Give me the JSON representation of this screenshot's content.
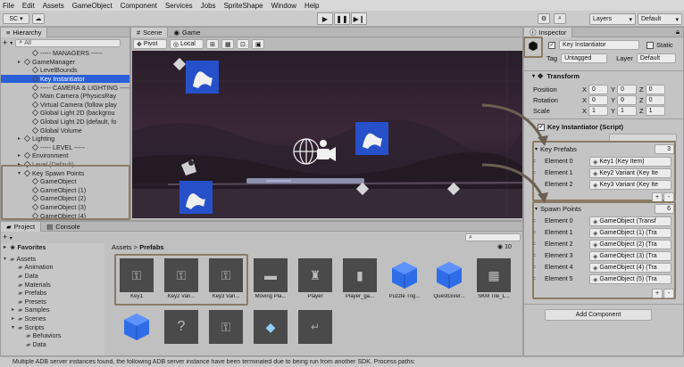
{
  "menu": [
    "File",
    "Edit",
    "Assets",
    "GameObject",
    "Component",
    "Services",
    "Jobs",
    "SpriteShape",
    "Window",
    "Help"
  ],
  "toolbar": {
    "account": "SC",
    "layers": "Layers",
    "layout": "Default"
  },
  "hierarchy": {
    "tab": "Hierarchy",
    "search_placeholder": "All",
    "items": [
      {
        "label": "----- MANAGERS -----",
        "indent": 2,
        "arrow": "",
        "state": ""
      },
      {
        "label": "GameManager",
        "indent": 1,
        "arrow": "▸",
        "state": ""
      },
      {
        "label": "LevelBounds",
        "indent": 2,
        "arrow": "",
        "state": ""
      },
      {
        "label": "Key Instantiator",
        "indent": 2,
        "arrow": "",
        "state": "sel"
      },
      {
        "label": "----- CAMERA & LIGHTING -----",
        "indent": 2,
        "arrow": "",
        "state": ""
      },
      {
        "label": "Main Camera (PhysicsRay",
        "indent": 2,
        "arrow": "",
        "state": ""
      },
      {
        "label": "Virtual Camera (follow play",
        "indent": 2,
        "arrow": "",
        "state": ""
      },
      {
        "label": "Global Light 2D (backgrou",
        "indent": 2,
        "arrow": "",
        "state": ""
      },
      {
        "label": "Global Light 2D (default, fo",
        "indent": 2,
        "arrow": "",
        "state": ""
      },
      {
        "label": "Global Volume",
        "indent": 2,
        "arrow": "",
        "state": ""
      },
      {
        "label": "Lighting",
        "indent": 1,
        "arrow": "▸",
        "state": ""
      },
      {
        "label": "----- LEVEL -----",
        "indent": 2,
        "arrow": "",
        "state": ""
      },
      {
        "label": "Environment",
        "indent": 1,
        "arrow": "▸",
        "state": ""
      },
      {
        "label": "Level (Default)",
        "indent": 1,
        "arrow": "▸",
        "state": "dim"
      },
      {
        "label": "Key Spawn Points",
        "indent": 1,
        "arrow": "▾",
        "state": ""
      },
      {
        "label": "GameObject",
        "indent": 2,
        "arrow": "",
        "state": ""
      },
      {
        "label": "GameObject (1)",
        "indent": 2,
        "arrow": "",
        "state": ""
      },
      {
        "label": "GameObject (2)",
        "indent": 2,
        "arrow": "",
        "state": ""
      },
      {
        "label": "GameObject (3)",
        "indent": 2,
        "arrow": "",
        "state": ""
      },
      {
        "label": "GameObject (4)",
        "indent": 2,
        "arrow": "",
        "state": ""
      }
    ]
  },
  "scene": {
    "tabs": [
      "Scene",
      "Game"
    ],
    "pivot": "Pivot",
    "space": "Local"
  },
  "project": {
    "tabs": [
      "Project",
      "Console"
    ],
    "breadcrumb": [
      "Assets",
      "Prefabs"
    ],
    "count": "10",
    "favorites": "Favorites",
    "tree": [
      {
        "label": "Assets",
        "indent": 0,
        "arrow": "▾"
      },
      {
        "label": "Animation",
        "indent": 1,
        "arrow": ""
      },
      {
        "label": "Data",
        "indent": 1,
        "arrow": ""
      },
      {
        "label": "Materials",
        "indent": 1,
        "arrow": ""
      },
      {
        "label": "Prefabs",
        "indent": 1,
        "arrow": ""
      },
      {
        "label": "Presets",
        "indent": 1,
        "arrow": ""
      },
      {
        "label": "Samples",
        "indent": 1,
        "arrow": "▸"
      },
      {
        "label": "Scenes",
        "indent": 1,
        "arrow": "▸"
      },
      {
        "label": "Scripts",
        "indent": 1,
        "arrow": "▾"
      },
      {
        "label": "Behaviors",
        "indent": 2,
        "arrow": ""
      },
      {
        "label": "Data",
        "indent": 2,
        "arrow": ""
      }
    ],
    "assets_row1": [
      "Key1",
      "Key2 Vari...",
      "Key3 Vari...",
      "Moving Pla...",
      "Player",
      "Player_ga...",
      "Puzzle Trig...",
      "QuestGiver...",
      "SKM Tile_L..."
    ]
  },
  "inspector": {
    "tab": "Inspector",
    "object_name": "Key Instantiator",
    "static_label": "Static",
    "tag_label": "Tag",
    "tag_value": "Untagged",
    "layer_label": "Layer",
    "layer_value": "Default",
    "transform": {
      "title": "Transform",
      "rows": [
        {
          "label": "Position",
          "x": "0",
          "y": "0",
          "z": "0"
        },
        {
          "label": "Rotation",
          "x": "0",
          "y": "0",
          "z": "0"
        },
        {
          "label": "Scale",
          "x": "1",
          "y": "1",
          "z": "1"
        }
      ]
    },
    "script": {
      "title": "Key Instantiator (Script)",
      "key_prefabs_label": "Key Prefabs",
      "key_prefabs_count": "3",
      "key_prefabs": [
        {
          "label": "Element 0",
          "value": "Key1 (Key Item)"
        },
        {
          "label": "Element 1",
          "value": "Key2 Variant (Key Ite"
        },
        {
          "label": "Element 2",
          "value": "Key3 Variant (Key Ite"
        }
      ],
      "spawn_points_label": "Spawn Points",
      "spawn_points_count": "6",
      "spawn_points": [
        {
          "label": "Element 0",
          "value": "GameObject (Transf"
        },
        {
          "label": "Element 1",
          "value": "GameObject (1) (Tra"
        },
        {
          "label": "Element 2",
          "value": "GameObject (2) (Tra"
        },
        {
          "label": "Element 3",
          "value": "GameObject (3) (Tra"
        },
        {
          "label": "Element 4",
          "value": "GameObject (4) (Tra"
        },
        {
          "label": "Element 5",
          "value": "GameObject (5) (Tra"
        }
      ]
    },
    "add_component": "Add Component"
  },
  "status": "Multiple ADB server instances found, the following ADB server instance have been terminated due to being run from another SDK. Process paths:",
  "colors": {
    "accent_blue": "#2a5fd8",
    "highlight_border": "#8b7a64",
    "key_blue": "#2650c9"
  }
}
